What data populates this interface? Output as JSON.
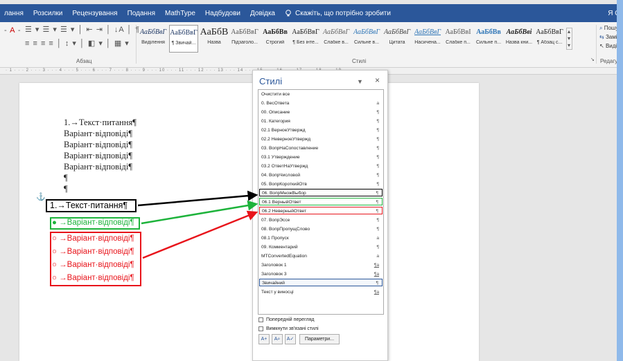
{
  "menubar": {
    "items": [
      "лання",
      "Розсилки",
      "Рецензування",
      "Подання",
      "MathType",
      "Надбудови",
      "Довідка"
    ],
    "tell_me": "Скажіть, що потрібно зробити",
    "account_glyph": "Я О"
  },
  "ribbon": {
    "paragraph_label": "Абзац",
    "styles_label": "Стилі",
    "editing_label": "Редагува",
    "styles_gallery": [
      {
        "preview": "АаБбВвГ",
        "name": "Виділення"
      },
      {
        "preview": "АаБбВвГ",
        "name": "¶ Звичай..."
      },
      {
        "preview": "АаБбВ",
        "name": "Назва"
      },
      {
        "preview": "АаБбВвГ",
        "name": "Підзаголо..."
      },
      {
        "preview": "АаБбВв",
        "name": "Строгий"
      },
      {
        "preview": "АаБбВвГ",
        "name": "¶ Без інте..."
      },
      {
        "preview": "АаБбВвГ",
        "name": "Слабке в..."
      },
      {
        "preview": "АаБбВвГ",
        "name": "Сильне в..."
      },
      {
        "preview": "АаБбВвГ",
        "name": "Цитата"
      },
      {
        "preview": "АаБбВвГ",
        "name": "Насичена..."
      },
      {
        "preview": "АаБбВвІ",
        "name": "Слабке п..."
      },
      {
        "preview": "АаБбВв",
        "name": "Сильне п..."
      },
      {
        "preview": "АаБбВві",
        "name": "Назва кни..."
      },
      {
        "preview": "АаБбВвГ",
        "name": "¶ Абзац с..."
      }
    ],
    "editing": [
      "Пошу",
      "Замін",
      "Виділ"
    ]
  },
  "ruler": {
    "ticks": "· 1 · · · 2 · · · 3 · · · 4 · · · 5 · · · 6 · · · 7 · · · 8 · · · 9 · · · 10 · · · 11 · · · 12 · · · 13 · · · 14 · · · 15 · · · 16 · · · 17 · · · 18 · · · 19 ·"
  },
  "document": {
    "top_block": {
      "question": "1.→Текст·питання¶",
      "answers": [
        "Варіант·відповіді¶",
        "Варіант·відповіді¶",
        "Варіант·відповіді¶",
        "Варіант·відповіді¶"
      ],
      "empty": [
        "¶",
        "¶"
      ]
    },
    "anchor": "⚓",
    "bottom_block": {
      "question": "1.→Текст·питання¶",
      "correct": "→Варіант·відповіді¶",
      "wrong": [
        "→Варіант·відповіді¶",
        "→Варіант·відповіді¶",
        "→Варіант·відповіді¶",
        "→Варіант·відповіді¶"
      ]
    }
  },
  "styles_pane": {
    "title": "Стилі",
    "close": "×",
    "items": [
      {
        "name": "Очистити все",
        "mark": ""
      },
      {
        "name": "0. ВесОтвета",
        "mark": "a"
      },
      {
        "name": "00. Описание",
        "mark": "¶"
      },
      {
        "name": "01. Категория",
        "mark": "¶"
      },
      {
        "name": "02.1 ВерноеУтвержд",
        "mark": "¶"
      },
      {
        "name": "02.2 НеверноеУтвержд",
        "mark": "¶"
      },
      {
        "name": "03. ВопрНаСопоставление",
        "mark": "¶"
      },
      {
        "name": "03.1 Утверждение",
        "mark": "¶"
      },
      {
        "name": "03.2 ОтветНаУтвержд",
        "mark": "¶"
      },
      {
        "name": "04. ВопрЧисловой",
        "mark": "¶"
      },
      {
        "name": "05. ВопрКороткийОтв",
        "mark": "¶"
      },
      {
        "name": "06. ВопрМножВыбор",
        "mark": "¶"
      },
      {
        "name": "06.1 ВерныйОтвет",
        "mark": "¶"
      },
      {
        "name": "06.2 НеверныйОтвет",
        "mark": "¶"
      },
      {
        "name": "07. ВопрЭссе",
        "mark": "¶"
      },
      {
        "name": "08. ВопрПропущСлово",
        "mark": "¶"
      },
      {
        "name": "08.1 Пропуск",
        "mark": "a"
      },
      {
        "name": "09. Комментарий",
        "mark": "¶"
      },
      {
        "name": "MTConvertedEquation",
        "mark": "a"
      },
      {
        "name": "Заголовок 1",
        "mark": "¶a"
      },
      {
        "name": "Заголовок 3",
        "mark": "¶a"
      },
      {
        "name": "Звичайний",
        "mark": "¶"
      },
      {
        "name": "Текст у виносці",
        "mark": "¶a"
      }
    ],
    "preview_checkbox": "Попередній перегляд",
    "disable_linked_checkbox": "Вимкнути зв'язані стилі",
    "options_button": "Параметри..."
  },
  "colors": {
    "accent": "#2b579a",
    "black_box": "#000000",
    "green_box": "#1db33b",
    "red_box": "#e8141b"
  }
}
